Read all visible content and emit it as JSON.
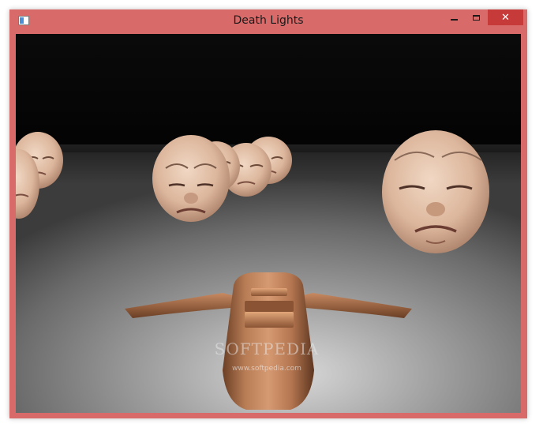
{
  "window": {
    "title": "Death Lights",
    "frame_color": "#d96a6a",
    "close_color": "#c73a3a"
  },
  "controls": {
    "minimize_icon": "minimize-icon",
    "maximize_icon": "maximize-icon",
    "close_icon": "close-icon",
    "close_glyph": "✕"
  },
  "scene": {
    "watermark": "SOFTPEDIA",
    "watermark_url": "www.softpedia.com",
    "sky_color": "#050505",
    "floor_color": "#8a8a8a",
    "ship_color": "#b27650"
  }
}
